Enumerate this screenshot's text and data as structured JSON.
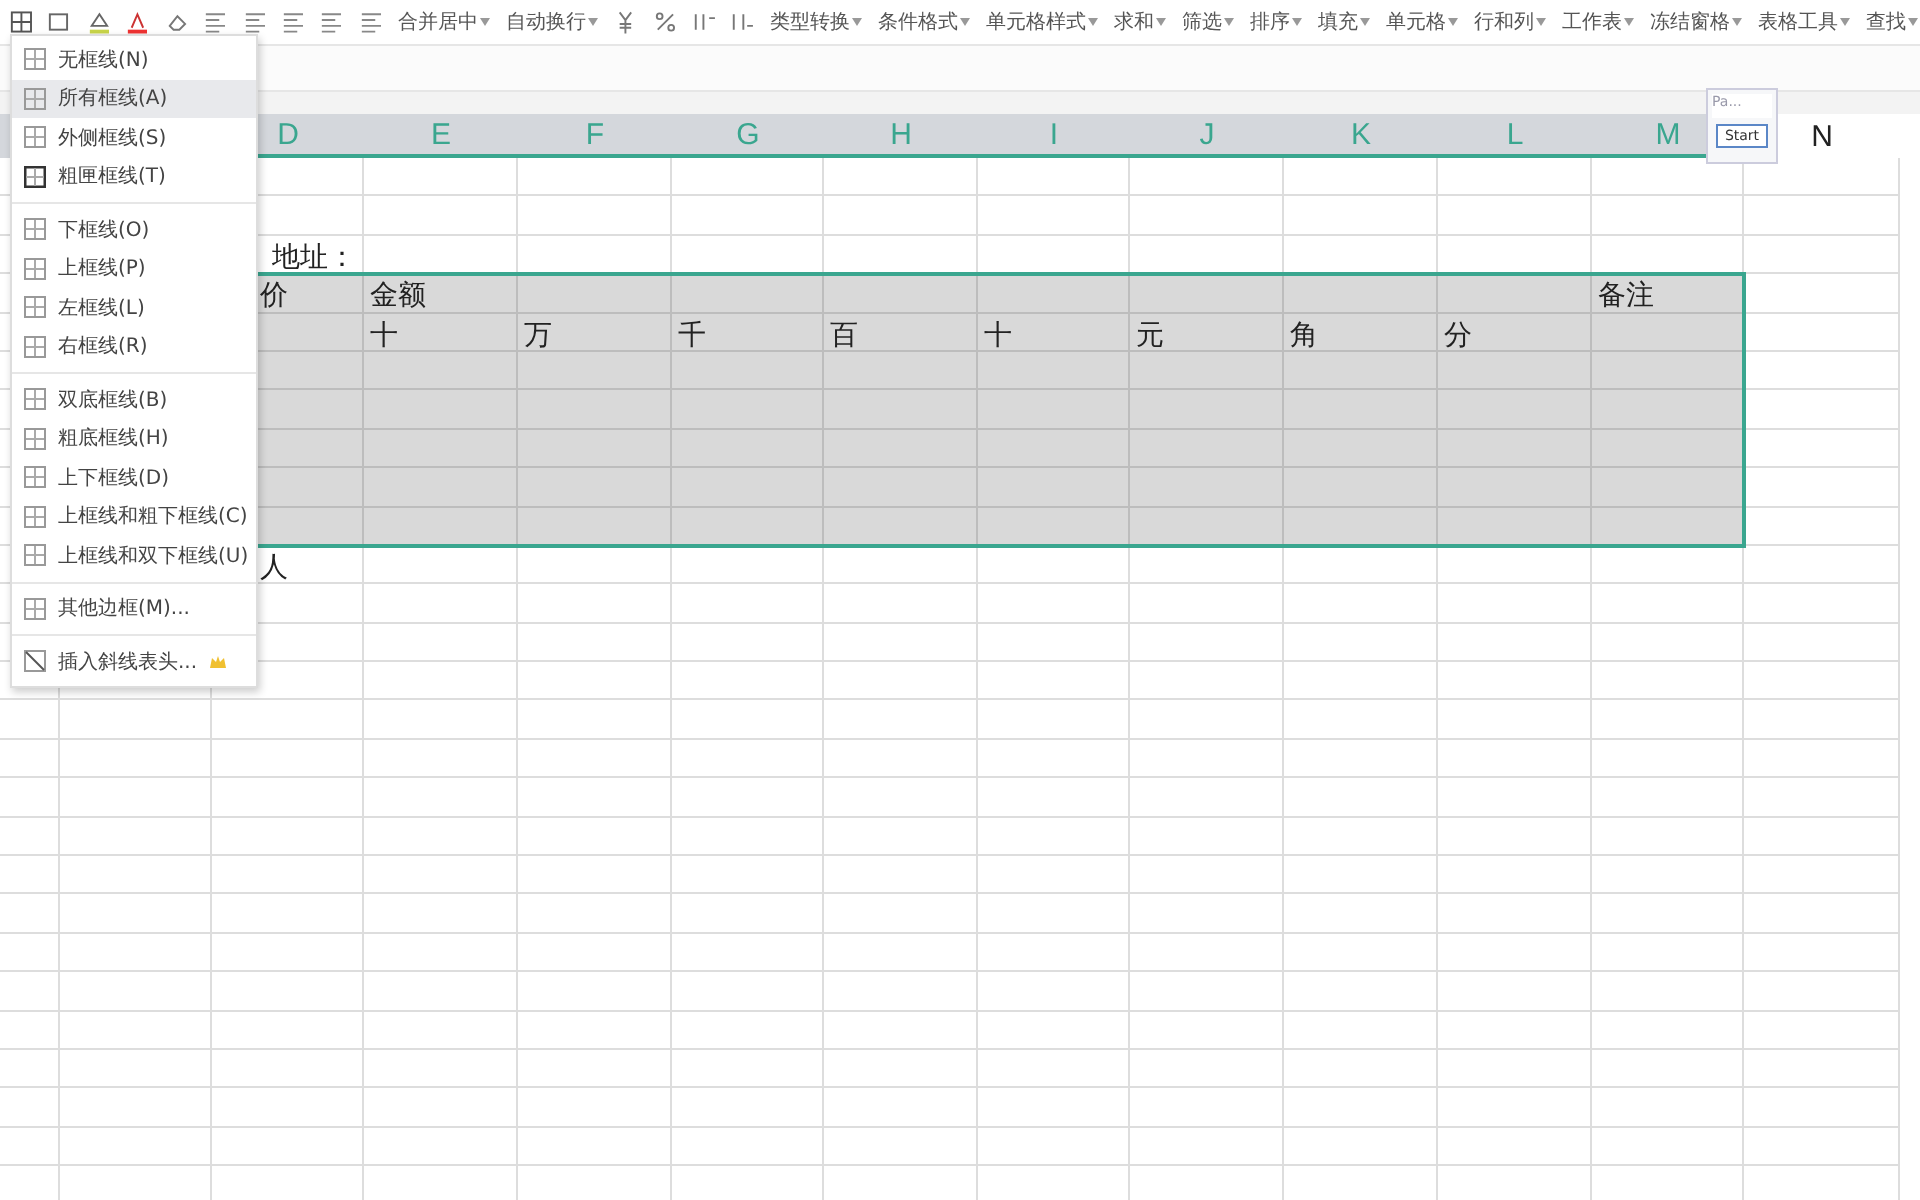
{
  "toolbar": {
    "items": [
      {
        "label": "合并居中"
      },
      {
        "label": "自动换行"
      },
      {
        "label": "类型转换"
      },
      {
        "label": "条件格式"
      },
      {
        "label": "单元格样式"
      },
      {
        "label": "求和"
      },
      {
        "label": "筛选"
      },
      {
        "label": "排序"
      },
      {
        "label": "填充"
      },
      {
        "label": "单元格"
      },
      {
        "label": "行和列"
      },
      {
        "label": "工作表"
      },
      {
        "label": "冻结窗格"
      },
      {
        "label": "表格工具"
      },
      {
        "label": "查找"
      }
    ]
  },
  "border_menu": {
    "groups": [
      [
        {
          "label": "无框线(N)",
          "selected": false
        },
        {
          "label": "所有框线(A)",
          "selected": true
        },
        {
          "label": "外侧框线(S)",
          "selected": false
        },
        {
          "label": "粗匣框线(T)",
          "selected": false
        }
      ],
      [
        {
          "label": "下框线(O)",
          "selected": false
        },
        {
          "label": "上框线(P)",
          "selected": false
        },
        {
          "label": "左框线(L)",
          "selected": false
        },
        {
          "label": "右框线(R)",
          "selected": false
        }
      ],
      [
        {
          "label": "双底框线(B)",
          "selected": false
        },
        {
          "label": "粗底框线(H)",
          "selected": false
        },
        {
          "label": "上下框线(D)",
          "selected": false
        },
        {
          "label": "上框线和粗下框线(C)",
          "selected": false
        },
        {
          "label": "上框线和双下框线(U)",
          "selected": false
        }
      ],
      [
        {
          "label": "其他边框(M)...",
          "selected": false
        }
      ],
      [
        {
          "label": "插入斜线表头...",
          "selected": false
        }
      ]
    ]
  },
  "sheet": {
    "columns": [
      {
        "label": "D",
        "selected": true
      },
      {
        "label": "E",
        "selected": true
      },
      {
        "label": "F",
        "selected": true
      },
      {
        "label": "G",
        "selected": true
      },
      {
        "label": "H",
        "selected": true
      },
      {
        "label": "I",
        "selected": true
      },
      {
        "label": "J",
        "selected": true
      },
      {
        "label": "K",
        "selected": true
      },
      {
        "label": "L",
        "selected": true
      },
      {
        "label": "M",
        "selected": true
      },
      {
        "label": "N",
        "selected": false
      }
    ],
    "rows": [
      {
        "selected": false,
        "cells": {}
      },
      {
        "selected": false,
        "cells": {}
      },
      {
        "selected": false,
        "cells": {
          "D": "地址："
        }
      },
      {
        "selected": true,
        "cells": {
          "D": "价",
          "E": "金额",
          "M": "备注"
        }
      },
      {
        "selected": true,
        "cells": {
          "E": "十",
          "F": "万",
          "G": "千",
          "H": "百",
          "I": "十",
          "J": "元",
          "K": "角",
          "L": "分"
        }
      },
      {
        "selected": true,
        "cells": {}
      },
      {
        "selected": true,
        "cells": {}
      },
      {
        "selected": true,
        "cells": {}
      },
      {
        "selected": true,
        "cells": {}
      },
      {
        "selected": true,
        "cells": {}
      },
      {
        "selected": false,
        "cells": {
          "D": "人"
        }
      },
      {
        "selected": false,
        "cells": {}
      },
      {
        "selected": false,
        "cells": {}
      },
      {
        "selected": false,
        "cells": {}
      },
      {
        "selected": false,
        "cells": {}
      },
      {
        "selected": false,
        "cells": {}
      },
      {
        "selected": false,
        "cells": {}
      },
      {
        "selected": false,
        "cells": {}
      },
      {
        "selected": false,
        "cells": {}
      },
      {
        "selected": false,
        "cells": {}
      },
      {
        "selected": false,
        "cells": {}
      },
      {
        "selected": false,
        "cells": {}
      },
      {
        "selected": false,
        "cells": {}
      },
      {
        "selected": false,
        "cells": {}
      },
      {
        "selected": false,
        "cells": {}
      },
      {
        "selected": false,
        "cells": {}
      },
      {
        "selected": false,
        "cells": {}
      }
    ]
  },
  "float_panel": {
    "field": "Pa...",
    "button": "Start"
  }
}
